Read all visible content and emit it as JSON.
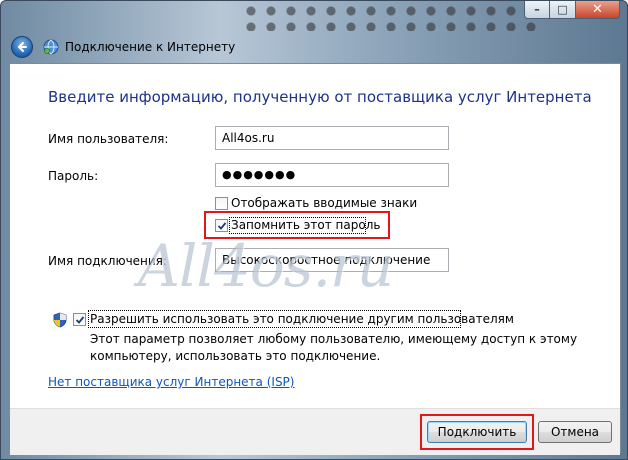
{
  "window": {
    "title": "Подключение к Интернету",
    "minimize_glyph": "–",
    "maximize_glyph": "□",
    "close_glyph": "✕"
  },
  "heading": "Введите информацию, полученную от поставщика услуг Интернета",
  "form": {
    "username_label": "Имя пользователя:",
    "username_value": "All4os.ru",
    "password_label": "Пароль:",
    "password_value": "●●●●●●●",
    "show_chars_label": "Отображать вводимые знаки",
    "show_chars_checked": false,
    "remember_label": "Запомнить этот пароль",
    "remember_checked": true,
    "connection_name_label": "Имя подключения:",
    "connection_name_value": "Высокоскоростное подключение"
  },
  "watermark": "All4os.ru",
  "share": {
    "label": "Разрешить использовать это подключение другим пользователям",
    "checked": true,
    "description": "Этот параметр позволяет любому пользователю, имеющему доступ к этому компьютеру, использовать это подключение."
  },
  "no_isp_link": "Нет поставщика услуг Интернета (ISP)",
  "buttons": {
    "connect": "Подключить",
    "cancel": "Отмена"
  },
  "colors": {
    "heading": "#1e3287",
    "link": "#0c57b8",
    "highlight": "#e0171b"
  },
  "icons": [
    "back-arrow-icon",
    "network-globe-icon",
    "uac-shield-icon",
    "checkmark-icon"
  ]
}
